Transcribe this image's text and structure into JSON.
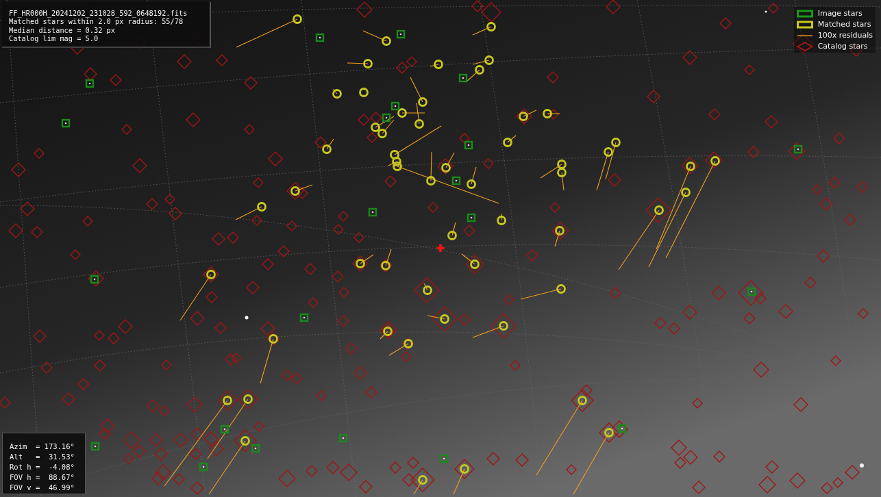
{
  "info_box": {
    "lines": [
      "FF_HR000H_20241202_231028_592_0648192.fits",
      "Matched stars within 2.0 px radius: 55/78",
      "Median distance = 0.32 px",
      "Catalog lim mag = 5.0"
    ]
  },
  "legend": [
    {
      "kind": "image",
      "label": "Image stars",
      "color": "#1a9a1a"
    },
    {
      "kind": "matched",
      "label": "Matched stars",
      "color": "#c8c820"
    },
    {
      "kind": "residual",
      "label": "100x residuals",
      "color": "#f0a020"
    },
    {
      "kind": "catalog",
      "label": "Catalog stars",
      "color": "#b01818"
    }
  ],
  "orientation_box": {
    "lines": [
      "Azim  = 173.16°",
      "Alt   =  31.53°",
      "Rot h =  -4.08°",
      "FOV h =  88.67°",
      "FOV v =  46.99°"
    ]
  }
}
